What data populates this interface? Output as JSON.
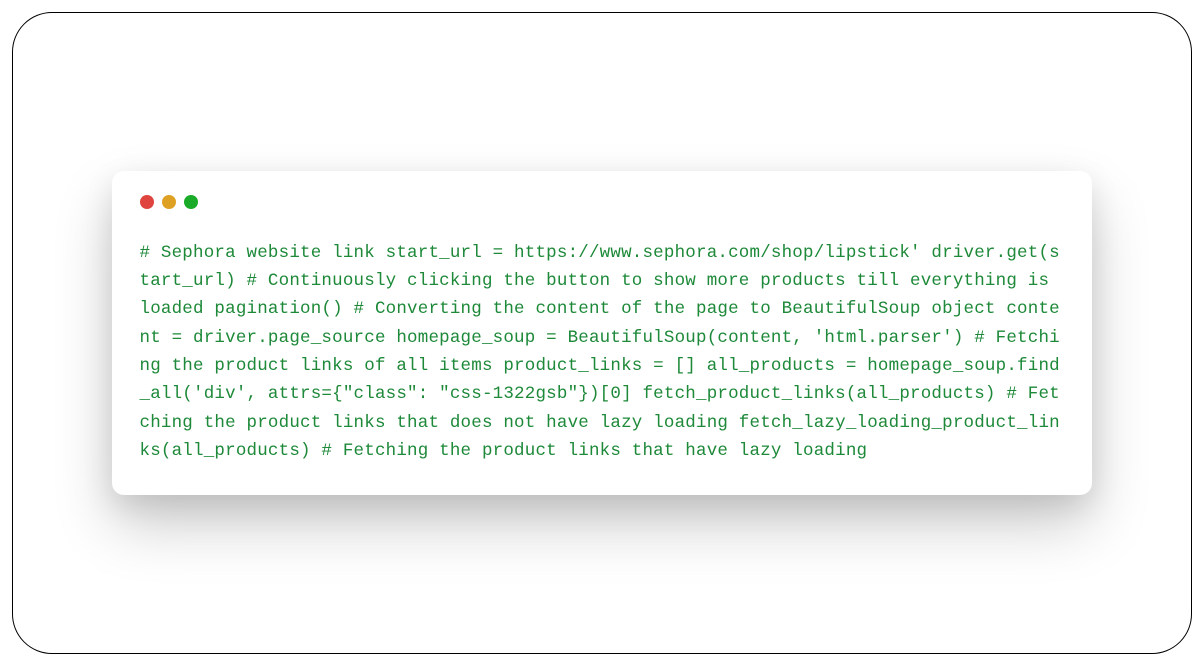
{
  "window": {
    "controls": {
      "red": "#e0443e",
      "yellow": "#dea123",
      "green": "#1aab29"
    }
  },
  "code": {
    "text": "# Sephora website link start_url = https://www.sephora.com/shop/lipstick' driver.get(start_url) # Continuously clicking the button to show more products till everything is loaded pagination() # Converting the content of the page to BeautifulSoup object content = driver.page_source homepage_soup = BeautifulSoup(content, 'html.parser') # Fetching the product links of all items product_links = [] all_products = homepage_soup.find_all('div', attrs={\"class\": \"css-1322gsb\"})[0] fetch_product_links(all_products) # Fetching the product links that does not have lazy loading fetch_lazy_loading_product_links(all_products) # Fetching the product links that have lazy loading",
    "color": "#1d8939"
  }
}
